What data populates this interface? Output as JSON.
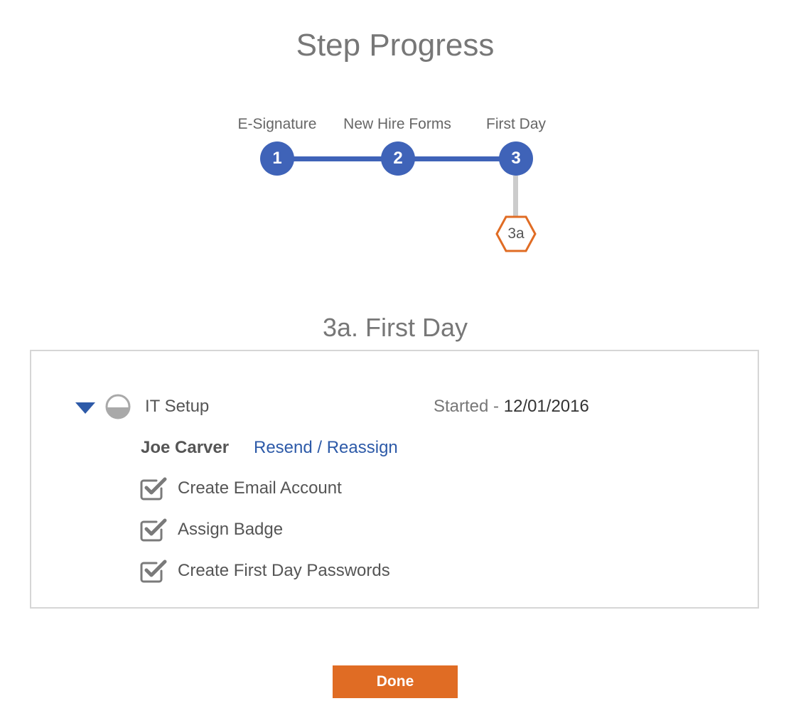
{
  "page": {
    "title": "Step Progress"
  },
  "stepper": {
    "steps": [
      {
        "number": "1",
        "label": "E-Signature"
      },
      {
        "number": "2",
        "label": "New Hire Forms"
      },
      {
        "number": "3",
        "label": "First Day"
      }
    ],
    "substep": {
      "label": "3a"
    },
    "colors": {
      "active_step": "#3f63b8",
      "substep_connector": "#cccccc",
      "substep_outline": "#e06c24"
    }
  },
  "section": {
    "title": "3a. First Day"
  },
  "task_group": {
    "name": "IT Setup",
    "expanded": true,
    "status_icon": "half-filled-circle-icon",
    "status_label": "Started -",
    "status_date": "12/01/2016",
    "assignee": "Joe Carver",
    "action_link": "Resend / Reassign",
    "items": [
      {
        "label": "Create Email Account",
        "checked": true
      },
      {
        "label": "Assign Badge",
        "checked": true
      },
      {
        "label": "Create First Day Passwords",
        "checked": true
      }
    ]
  },
  "footer": {
    "done_label": "Done",
    "done_color": "#e06c24"
  }
}
